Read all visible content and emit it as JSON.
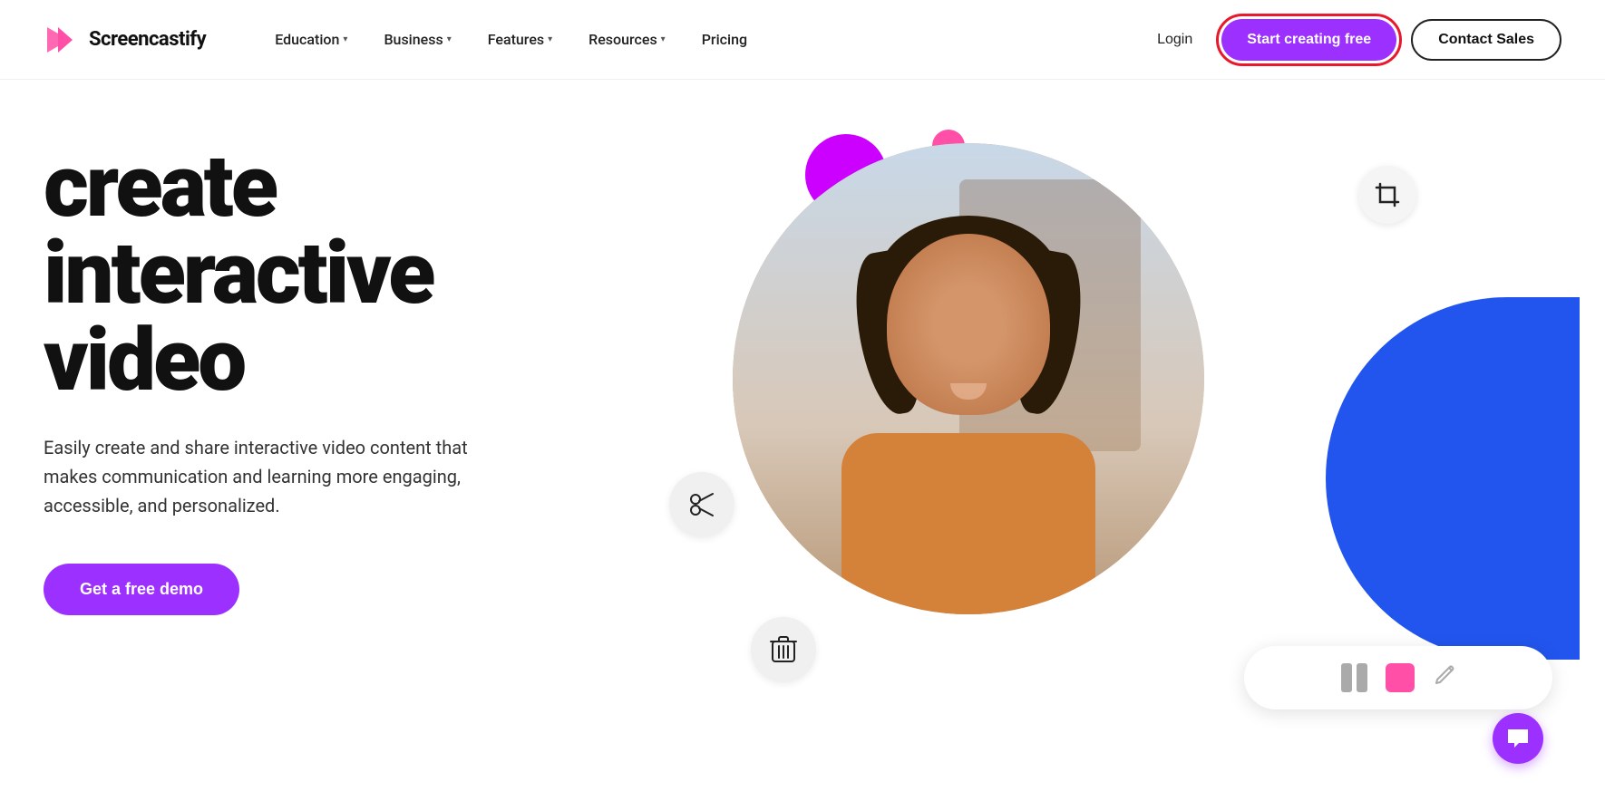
{
  "brand": {
    "name_screen": "Screen",
    "name_castify": "castify",
    "full_name": "Screencastify"
  },
  "nav": {
    "links": [
      {
        "id": "education",
        "label": "Education",
        "has_dropdown": true
      },
      {
        "id": "business",
        "label": "Business",
        "has_dropdown": true
      },
      {
        "id": "features",
        "label": "Features",
        "has_dropdown": true
      },
      {
        "id": "resources",
        "label": "Resources",
        "has_dropdown": true
      },
      {
        "id": "pricing",
        "label": "Pricing",
        "has_dropdown": false
      }
    ],
    "login_label": "Login",
    "start_label": "Start creating free",
    "contact_label": "Contact Sales"
  },
  "hero": {
    "title_line1": "create",
    "title_line2": "interactive",
    "title_line3": "video",
    "subtitle": "Easily create and share interactive video content that makes communication and learning more engaging, accessible, and personalized.",
    "cta_label": "Get a free demo"
  },
  "decorations": {
    "crop_icon": "⌗",
    "scissors_icon": "✂",
    "trash_icon": "🗑",
    "chat_icon": "💬",
    "pause_color": "#aaaaaa",
    "stop_color": "#ff4fa7",
    "edit_icon": "✏",
    "circle_purple": "#cc00ff",
    "circle_pink": "#ff4fa7",
    "blue_accent": "#2255ee"
  }
}
